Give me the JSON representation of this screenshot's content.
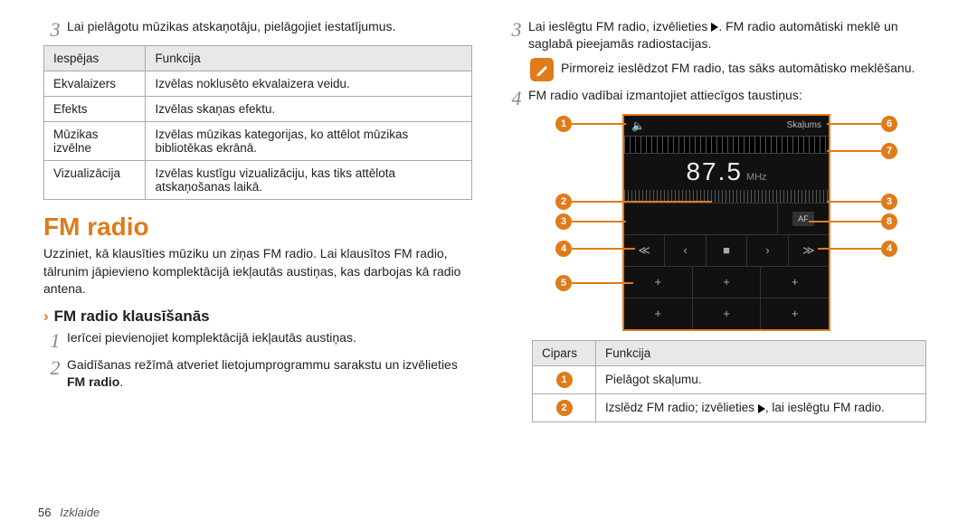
{
  "left": {
    "step3": "Lai pielāgotu mūzikas atskaņotāju, pielāgojiet iestatījumus.",
    "table": {
      "h1": "Iespējas",
      "h2": "Funkcija",
      "rows": [
        {
          "a": "Ekvalaizers",
          "b": "Izvēlas noklusēto ekvalaizera veidu."
        },
        {
          "a": "Efekts",
          "b": "Izvēlas skaņas efektu."
        },
        {
          "a": "Mūzikas izvēlne",
          "b": "Izvēlas mūzikas kategorijas, ko attēlot mūzikas bibliotēkas ekrānā."
        },
        {
          "a": "Vizualizācija",
          "b": "Izvēlas kustīgu vizualizāciju, kas tiks attēlota atskaņošanas laikā."
        }
      ]
    },
    "heading": "FM radio",
    "body": "Uzziniet, kā klausīties mūziku un ziņas FM radio. Lai klausītos FM radio, tālrunim jāpievieno komplektācijā iekļautās austiņas, kas darbojas kā radio antena.",
    "subheading": "FM radio klausīšanās",
    "step1": "Ierīcei pievienojiet komplektācijā iekļautās austiņas.",
    "step2a": "Gaidīšanas režīmā atveriet lietojumprogrammu sarakstu un izvēlieties ",
    "step2b": "FM radio",
    "step2c": "."
  },
  "right": {
    "step3a": "Lai ieslēgtu FM radio, izvēlieties ",
    "step3b": ". FM radio automātiski meklē un saglabā pieejamās radiostacijas.",
    "note": "Pirmoreiz ieslēdzot FM radio, tas sāks automātisko meklēšanu.",
    "step4": "FM radio vadībai izmantojiet attiecīgos taustiņus:",
    "fm": {
      "status": "Skaļums",
      "freq": "87.5",
      "unit": "MHz",
      "af": "AF"
    },
    "table": {
      "h1": "Cipars",
      "h2": "Funkcija",
      "rows": [
        {
          "n": "1",
          "b": "Pielāgot skaļumu."
        },
        {
          "n": "2",
          "ba": "Izslēdz FM radio; izvēlieties ",
          "bb": ", lai ieslēgtu FM radio."
        }
      ]
    }
  },
  "footer": {
    "page": "56",
    "section": "Izklaide"
  }
}
